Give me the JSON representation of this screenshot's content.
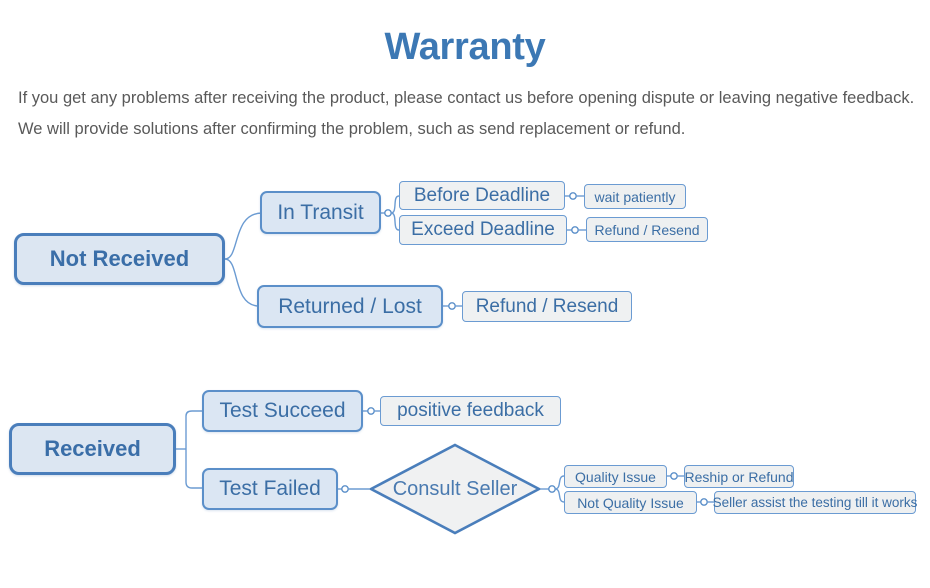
{
  "header": {
    "title": "Warranty",
    "intro": "If you get any problems after receiving the product, please contact us before opening dispute or leaving negative feedback. We will provide solutions after confirming the problem, such as send replacement or refund."
  },
  "colors": {
    "title": "#3c78b4",
    "body_text": "#595959",
    "node_text": "#3b6ea5",
    "root_border": "#4a7ebb",
    "root_fill": "#dce6f2",
    "branch_border": "#5b8fc9",
    "leaf_fill": "#eef0f1",
    "connector": "#6b9bd2"
  },
  "flow": {
    "not_received": {
      "root": "Not Received",
      "in_transit": "In Transit",
      "before_deadline": "Before Deadline",
      "before_deadline_action": "wait patiently",
      "exceed_deadline": "Exceed Deadline",
      "exceed_deadline_action": "Refund / Resend",
      "returned_lost": "Returned / Lost",
      "returned_lost_action": "Refund / Resend"
    },
    "received": {
      "root": "Received",
      "test_succeed": "Test Succeed",
      "test_succeed_action": "positive feedback",
      "test_failed": "Test Failed",
      "consult_seller": "Consult Seller",
      "quality_issue": "Quality Issue",
      "quality_issue_action": "Reship or Refund",
      "not_quality_issue": "Not Quality Issue",
      "not_quality_issue_action": "Seller assist the testing till it works"
    }
  }
}
